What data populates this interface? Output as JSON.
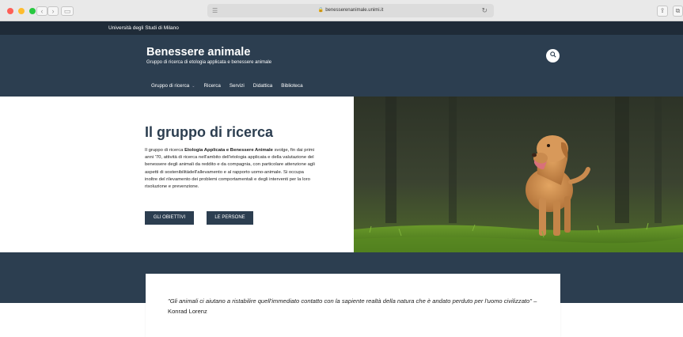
{
  "browser": {
    "url": "benesserenanimale.unimi.it",
    "traffic_lights": [
      "#fe5f57",
      "#febc2e",
      "#28c840"
    ]
  },
  "topbar": {
    "university": "Università degli Studi di Milano"
  },
  "header": {
    "title": "Benessere animale",
    "subtitle": "Gruppo di ricerca di etologia applicata e benessere animale",
    "nav": [
      {
        "label": "Gruppo di ricerca",
        "has_dropdown": true
      },
      {
        "label": "Ricerca"
      },
      {
        "label": "Servizi"
      },
      {
        "label": "Didattica"
      },
      {
        "label": "Biblioteca"
      }
    ]
  },
  "hero": {
    "title": "Il gruppo di ricerca",
    "text_prefix": "Il gruppo di ricerca ",
    "text_bold": "Etologia Applicata e Benessere Animale",
    "text_rest": " svolge, fin dai primi anni '70, attività di ricerca nell'ambito dell'etologia applicata e della valutazione del benessere degli animali da reddito e da compagnia, con particolare attenzione agli aspetti di sostenibilitàdell'allevamento e al rapporto uomo-animale. Si occupa inoltre del rilevamento dei problemi comportamentali e degli interventi per la loro risoluzione e prevenzione.",
    "buttons": {
      "objectives": "GLI OBIETTIVI",
      "people": "LE PERSONE"
    }
  },
  "quote": {
    "text": "\"Gli animali ci aiutano a ristabilire quell'immediato contatto con la sapiente realtà della natura che è andato perduto per l'uomo civilizzato\"",
    "author": " – Konrad Lorenz"
  },
  "colors": {
    "primary": "#2c3e50",
    "dark": "#1f2b38"
  }
}
